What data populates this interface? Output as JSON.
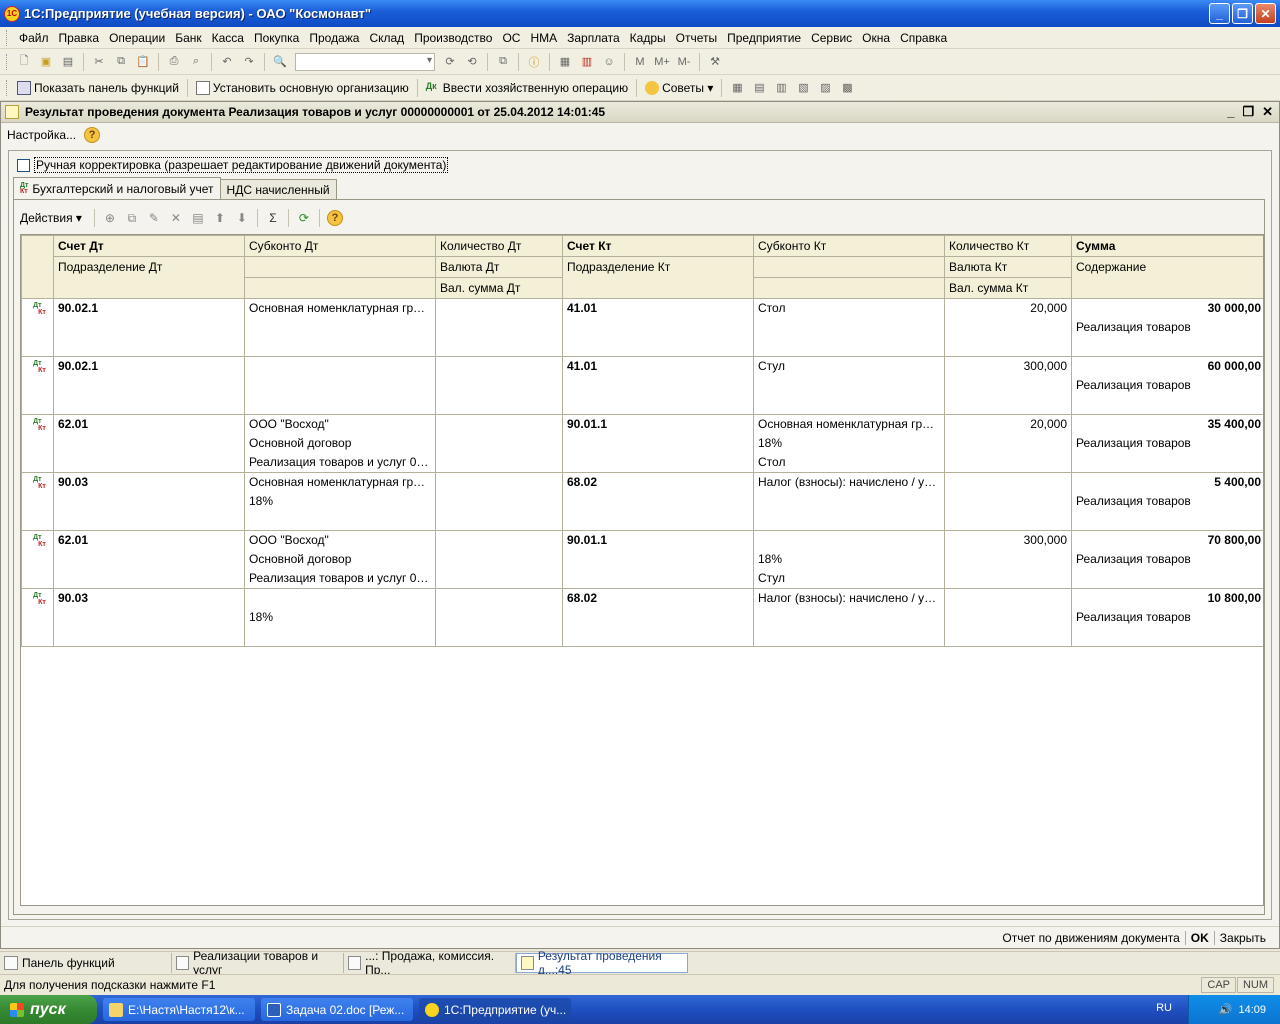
{
  "window": {
    "title": "1С:Предприятие (учебная версия) - ОАО \"Космонавт\""
  },
  "menu": [
    "Файл",
    "Правка",
    "Операции",
    "Банк",
    "Касса",
    "Покупка",
    "Продажа",
    "Склад",
    "Производство",
    "ОС",
    "НМА",
    "Зарплата",
    "Кадры",
    "Отчеты",
    "Предприятие",
    "Сервис",
    "Окна",
    "Справка"
  ],
  "toolbar2": {
    "show_panel": "Показать панель функций",
    "set_org": "Установить основную организацию",
    "enter_op": "Ввести хозяйственную операцию",
    "tips": "Советы"
  },
  "doc": {
    "title": "Результат проведения документа Реализация товаров и услуг 00000000001 от 25.04.2012 14:01:45",
    "settings": "Настройка...",
    "manual_edit": "Ручная корректировка (разрешает редактирование движений документа)",
    "tabs": [
      "Бухгалтерский и налоговый учет",
      "НДС начисленный"
    ],
    "actions": "Действия",
    "footer": {
      "report": "Отчет по движениям документа",
      "ok": "OK",
      "close": "Закрыть"
    }
  },
  "grid": {
    "headers": {
      "r1": [
        "Счет Дт",
        "Субконто Дт",
        "Количество Дт",
        "Счет Кт",
        "Субконто Кт",
        "Количество Кт",
        "Сумма"
      ],
      "r2": [
        "Подразделение Дт",
        "",
        "Валюта Дт",
        "Подразделение Кт",
        "",
        "Валюта Кт",
        "Содержание"
      ],
      "r3": [
        "",
        "",
        "Вал. сумма Дт",
        "",
        "",
        "Вал. сумма Кт",
        ""
      ]
    },
    "rows": [
      {
        "dt": "90.02.1",
        "sub_dt": [
          "Основная номенклатурная группа",
          "",
          ""
        ],
        "kt": "41.01",
        "sub_kt": [
          "Стол",
          "",
          ""
        ],
        "qty_kt": "20,000",
        "sum": "30 000,00",
        "content": "Реализация товаров"
      },
      {
        "dt": "90.02.1",
        "sub_dt": [
          "",
          "",
          ""
        ],
        "kt": "41.01",
        "sub_kt": [
          "Стул",
          "",
          ""
        ],
        "qty_kt": "300,000",
        "sum": "60 000,00",
        "content": "Реализация товаров"
      },
      {
        "dt": "62.01",
        "sub_dt": [
          "ООО \"Восход\"",
          "Основной договор",
          "Реализация товаров и услуг 0000..."
        ],
        "kt": "90.01.1",
        "sub_kt": [
          "Основная номенклатурная группа",
          "18%",
          "Стол"
        ],
        "qty_kt": "20,000",
        "sum": "35 400,00",
        "content": "Реализация товаров"
      },
      {
        "dt": "90.03",
        "sub_dt": [
          "Основная номенклатурная группа",
          "18%",
          ""
        ],
        "kt": "68.02",
        "sub_kt": [
          "Налог (взносы): начислено / упла...",
          "",
          ""
        ],
        "qty_kt": "",
        "sum": "5 400,00",
        "content": "Реализация товаров"
      },
      {
        "dt": "62.01",
        "sub_dt": [
          "ООО \"Восход\"",
          "Основной договор",
          "Реализация товаров и услуг 0000..."
        ],
        "kt": "90.01.1",
        "sub_kt": [
          "",
          "18%",
          "Стул"
        ],
        "qty_kt": "300,000",
        "sum": "70 800,00",
        "content": "Реализация товаров"
      },
      {
        "dt": "90.03",
        "sub_dt": [
          "",
          "18%",
          ""
        ],
        "kt": "68.02",
        "sub_kt": [
          "Налог (взносы): начислено / упла...",
          "",
          ""
        ],
        "qty_kt": "",
        "sum": "10 800,00",
        "content": "Реализация товаров"
      }
    ]
  },
  "windowbar": [
    "Панель функций",
    "Реализации товаров и услуг",
    "...: Продажа, комиссия. Пр...",
    "Результат проведения д...:45"
  ],
  "status": {
    "hint": "Для получения подсказки нажмите F1",
    "cap": "CAP",
    "num": "NUM"
  },
  "taskbar": {
    "start": "пуск",
    "items": [
      "E:\\Настя\\Настя12\\к...",
      "Задача 02.doc [Реж...",
      "1С:Предприятие (уч..."
    ],
    "lang": "RU",
    "time": "14:09"
  }
}
